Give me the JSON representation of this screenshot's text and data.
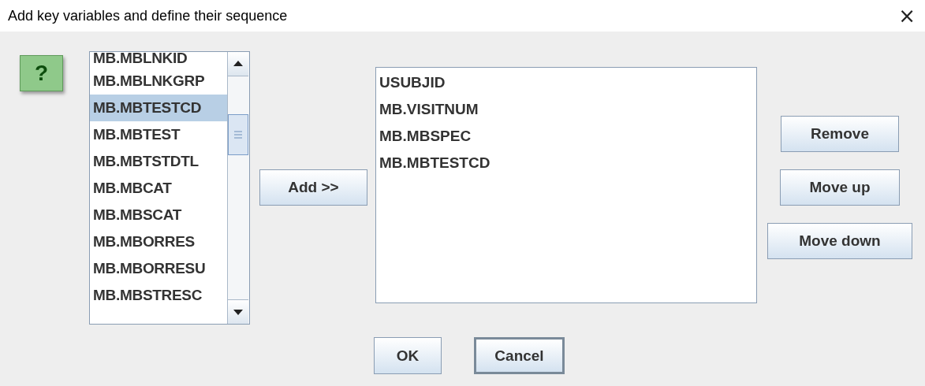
{
  "window": {
    "title": "Add key variables and define their sequence",
    "close": "×"
  },
  "help_button": {
    "label": "?"
  },
  "available_list": {
    "items": [
      {
        "label": "MB.MBLNKID",
        "selected": false
      },
      {
        "label": "MB.MBLNKGRP",
        "selected": false
      },
      {
        "label": "MB.MBTESTCD",
        "selected": true
      },
      {
        "label": "MB.MBTEST",
        "selected": false
      },
      {
        "label": "MB.MBTSTDTL",
        "selected": false
      },
      {
        "label": "MB.MBCAT",
        "selected": false
      },
      {
        "label": "MB.MBSCAT",
        "selected": false
      },
      {
        "label": "MB.MBORRES",
        "selected": false
      },
      {
        "label": "MB.MBORRESU",
        "selected": false
      },
      {
        "label": "MB.MBSTRESC",
        "selected": false
      }
    ]
  },
  "add_button": "Add >>",
  "key_list": {
    "items": [
      "USUBJID",
      "MB.VISITNUM",
      "MB.MBSPEC",
      "MB.MBTESTCD"
    ]
  },
  "side_buttons": [
    "Remove",
    "Move up",
    "Move down"
  ],
  "footer_buttons": [
    {
      "label": "OK",
      "default": false
    },
    {
      "label": "Cancel",
      "default": true
    }
  ]
}
